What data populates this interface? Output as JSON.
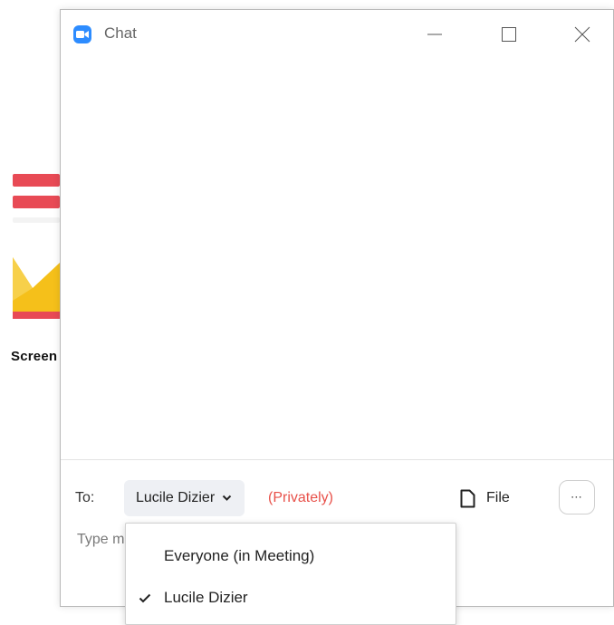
{
  "background_app": {
    "label": "Screen",
    "colors": {
      "red": "#e84a55",
      "yellow": "#f5c01a",
      "orange": "#f0a52c"
    }
  },
  "window": {
    "title": "Chat",
    "app_icon": "video-camera-icon",
    "controls": {
      "minimize": "minimize-icon",
      "maximize": "maximize-icon",
      "close": "close-icon"
    }
  },
  "composer": {
    "to_label": "To:",
    "recipient": "Lucile Dizier",
    "privately": "(Privately)",
    "file_label": "File",
    "more_label": "⋯",
    "input_placeholder": "Type message here..."
  },
  "dropdown": {
    "items": [
      {
        "label": "Everyone (in Meeting)",
        "selected": false
      },
      {
        "label": "Lucile Dizier",
        "selected": true
      }
    ]
  },
  "colors": {
    "accent": "#2d8cff",
    "private": "#e8514a",
    "select_bg": "#eef0f4"
  }
}
